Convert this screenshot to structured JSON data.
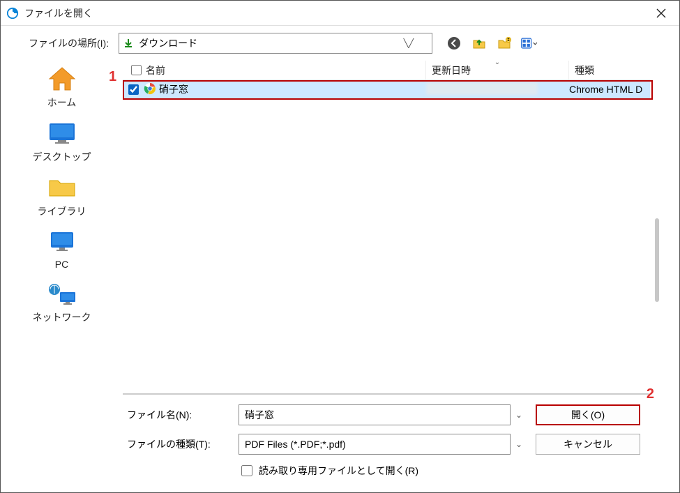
{
  "title": "ファイルを開く",
  "location": {
    "label": "ファイルの場所(I):",
    "value": "ダウンロード"
  },
  "sidebar": {
    "items": [
      {
        "label": "ホーム"
      },
      {
        "label": "デスクトップ"
      },
      {
        "label": "ライブラリ"
      },
      {
        "label": "PC"
      },
      {
        "label": "ネットワーク"
      }
    ]
  },
  "columns": {
    "name": "名前",
    "date": "更新日時",
    "kind": "種類"
  },
  "rows": [
    {
      "name": "硝子窓",
      "kind": "Chrome HTML D"
    }
  ],
  "form": {
    "filename_label": "ファイル名(N):",
    "filename_value": "硝子窓",
    "filetype_label": "ファイルの種類(T):",
    "filetype_value": "PDF Files (*.PDF;*.pdf)",
    "open_label": "開く(O)",
    "cancel_label": "キャンセル",
    "readonly_label": "読み取り専用ファイルとして開く(R)"
  },
  "annotations": {
    "n1": "1",
    "n2": "2"
  }
}
